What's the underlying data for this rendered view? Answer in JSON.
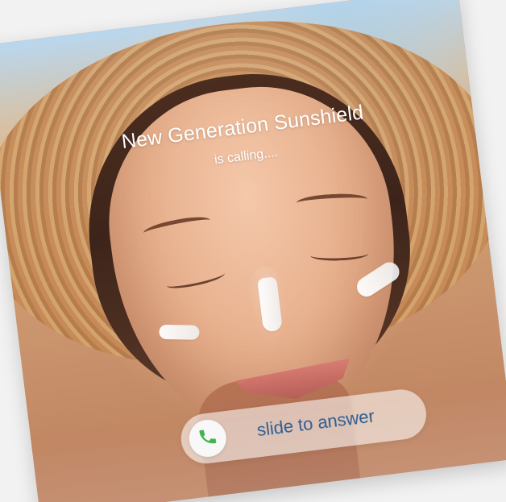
{
  "call": {
    "name": "New Generation Sunshield",
    "status": "is calling....",
    "slider_label": "slide to answer"
  },
  "icons": {
    "phone": "phone-icon"
  },
  "colors": {
    "slider_text": "#2d5f94",
    "phone_green": "#43b34f",
    "overlay_text": "#ffffff",
    "knob_bg": "#f8f8f8"
  }
}
